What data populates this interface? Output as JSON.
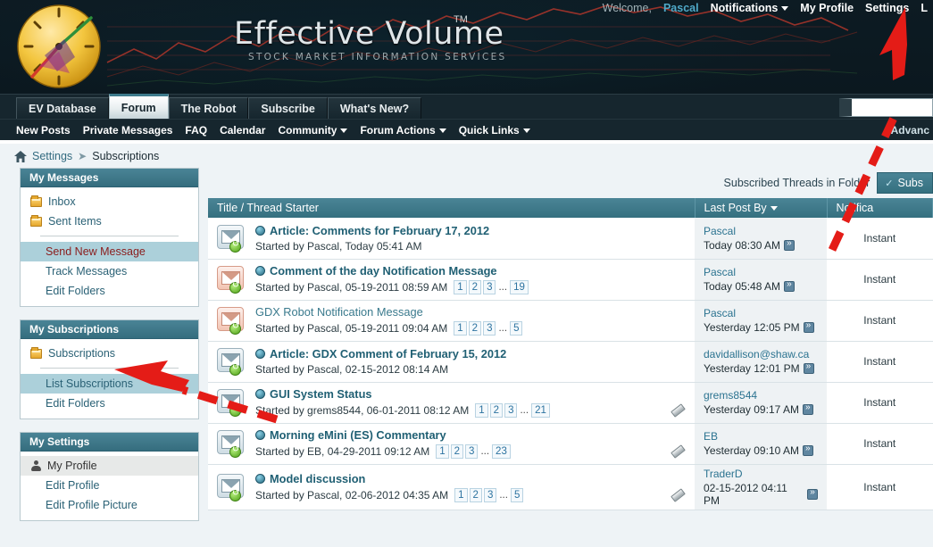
{
  "header": {
    "brand_title": "Effective Volume",
    "brand_tm": "TM",
    "brand_subtitle": "STOCK MARKET INFORMATION SERVICES",
    "welcome_label": "Welcome,",
    "username": "Pascal",
    "nav": [
      {
        "label": "Notifications",
        "has_caret": true
      },
      {
        "label": "My Profile",
        "has_caret": false
      },
      {
        "label": "Settings",
        "has_caret": false
      },
      {
        "label": "L",
        "has_caret": false
      }
    ]
  },
  "tabs": [
    {
      "label": "EV Database",
      "active": false
    },
    {
      "label": "Forum",
      "active": true
    },
    {
      "label": "The Robot",
      "active": false
    },
    {
      "label": "Subscribe",
      "active": false
    },
    {
      "label": "What's New?",
      "active": false
    }
  ],
  "search": {
    "value": "",
    "placeholder": ""
  },
  "subnav": {
    "items": [
      {
        "label": "New Posts",
        "has_caret": false
      },
      {
        "label": "Private Messages",
        "has_caret": false
      },
      {
        "label": "FAQ",
        "has_caret": false
      },
      {
        "label": "Calendar",
        "has_caret": false
      },
      {
        "label": "Community",
        "has_caret": true
      },
      {
        "label": "Forum Actions",
        "has_caret": true
      },
      {
        "label": "Quick Links",
        "has_caret": true
      }
    ],
    "advanced_label": "Advanc"
  },
  "breadcrumb": {
    "home_icon": "home-icon",
    "items": [
      "Settings",
      "Subscriptions"
    ]
  },
  "sidebar": {
    "panels": [
      {
        "title": "My Messages",
        "items": [
          {
            "label": "Inbox",
            "icon": "folder-icon",
            "style": "folder"
          },
          {
            "label": "Sent Items",
            "icon": "folder-icon",
            "style": "folder"
          },
          {
            "divider": true
          },
          {
            "label": "Send New Message",
            "style": "selected-red"
          },
          {
            "label": "Track Messages",
            "style": "sub"
          },
          {
            "label": "Edit Folders",
            "style": "sub"
          }
        ]
      },
      {
        "title": "My Subscriptions",
        "items": [
          {
            "label": "Subscriptions",
            "icon": "folder-icon",
            "style": "folder"
          },
          {
            "divider": true
          },
          {
            "label": "List Subscriptions",
            "style": "selected"
          },
          {
            "label": "Edit Folders",
            "style": "sub"
          }
        ]
      },
      {
        "title": "My Settings",
        "items": [
          {
            "label": "My Profile",
            "icon": "person-icon",
            "style": "gray"
          },
          {
            "label": "Edit Profile",
            "style": "sub"
          },
          {
            "label": "Edit Profile Picture",
            "style": "sub"
          }
        ]
      }
    ]
  },
  "main": {
    "folder_label": "Subscribed Threads in Folder",
    "folder_value": "Subs",
    "columns": {
      "title": "Title / Thread Starter",
      "last_post": "Last Post By",
      "last_post_sort": "desc",
      "notification": "Notifica"
    },
    "threads": [
      {
        "title": "Article: Comments for February 17, 2012",
        "bold": true,
        "has_dot": true,
        "icon_color": "blue",
        "starter": "Started by Pascal, Today 05:41 AM",
        "pages": [],
        "has_attachment": false,
        "last_post_by": "Pascal",
        "last_post_date": "Today 08:30 AM",
        "notification": "Instant"
      },
      {
        "title": "Comment of the day Notification Message",
        "bold": true,
        "has_dot": true,
        "icon_color": "orange",
        "starter": "Started by Pascal, 05-19-2011 08:59 AM",
        "pages": [
          "1",
          "2",
          "3",
          "...",
          "19"
        ],
        "has_attachment": false,
        "last_post_by": "Pascal",
        "last_post_date": "Today 05:48 AM",
        "notification": "Instant"
      },
      {
        "title": "GDX Robot Notification Message",
        "bold": false,
        "has_dot": false,
        "icon_color": "orange",
        "starter": "Started by Pascal, 05-19-2011 09:04 AM",
        "pages": [
          "1",
          "2",
          "3",
          "...",
          "5"
        ],
        "has_attachment": false,
        "last_post_by": "Pascal",
        "last_post_date": "Yesterday 12:05 PM",
        "notification": "Instant"
      },
      {
        "title": "Article: GDX Comment of February 15, 2012",
        "bold": true,
        "has_dot": true,
        "icon_color": "blue",
        "starter": "Started by Pascal, 02-15-2012 08:14 AM",
        "pages": [],
        "has_attachment": false,
        "last_post_by": "davidallison@shaw.ca",
        "last_post_date": "Yesterday 12:01 PM",
        "notification": "Instant"
      },
      {
        "title": "GUI System Status",
        "bold": true,
        "has_dot": true,
        "icon_color": "blue",
        "starter": "Started by grems8544, 06-01-2011 08:12 AM",
        "pages": [
          "1",
          "2",
          "3",
          "...",
          "21"
        ],
        "has_attachment": true,
        "last_post_by": "grems8544",
        "last_post_date": "Yesterday 09:17 AM",
        "notification": "Instant"
      },
      {
        "title": "Morning eMini (ES) Commentary",
        "bold": true,
        "has_dot": true,
        "icon_color": "blue",
        "starter": "Started by EB, 04-29-2011 09:12 AM",
        "pages": [
          "1",
          "2",
          "3",
          "...",
          "23"
        ],
        "has_attachment": true,
        "last_post_by": "EB",
        "last_post_date": "Yesterday 09:10 AM",
        "notification": "Instant"
      },
      {
        "title": "Model discussion",
        "bold": true,
        "has_dot": true,
        "icon_color": "blue",
        "starter": "Started by Pascal, 02-06-2012 04:35 AM",
        "pages": [
          "1",
          "2",
          "3",
          "...",
          "5"
        ],
        "has_attachment": true,
        "last_post_by": "TraderD",
        "last_post_date": "02-15-2012 04:11 PM",
        "notification": "Instant"
      }
    ]
  },
  "annotations": {
    "arrow_color": "#e41c17",
    "arrows": [
      {
        "name": "arrow-to-settings",
        "target": "Settings"
      },
      {
        "name": "arrow-to-subscriptions",
        "target": "Subscriptions"
      }
    ]
  }
}
